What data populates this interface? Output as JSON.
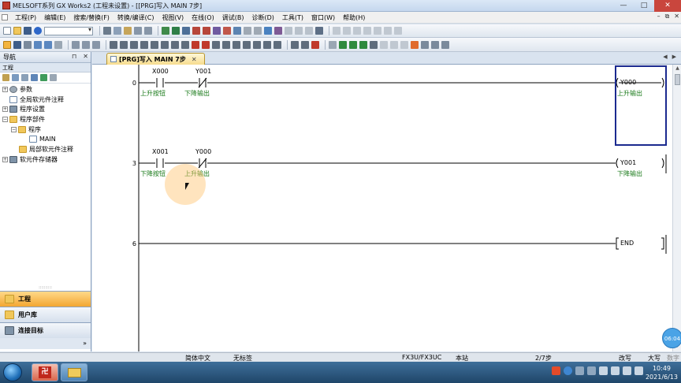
{
  "window": {
    "title": "MELSOFT系列 GX Works2 (工程未设置) - [[PRG]写入 MAIN 7步]",
    "btn_minimize": "—",
    "btn_maximize": "□",
    "btn_close": "✕"
  },
  "menubar": {
    "items": [
      "工程(P)",
      "编辑(E)",
      "搜索/替换(F)",
      "转换/编译(C)",
      "视图(V)",
      "在线(O)",
      "调试(B)",
      "诊断(D)",
      "工具(T)",
      "窗口(W)",
      "帮助(H)"
    ],
    "mdi_buttons": [
      "–",
      "⧉",
      "✕"
    ]
  },
  "navigation": {
    "title": "导航",
    "header_buttons": [
      "⊓",
      "✕"
    ],
    "section_label": "工程",
    "tree": [
      {
        "label": "参数",
        "depth": 0,
        "expander": "+",
        "icon": "gear-icon"
      },
      {
        "label": "全局软元件注释",
        "depth": 0,
        "expander": "",
        "icon": "comment-icon"
      },
      {
        "label": "程序设置",
        "depth": 0,
        "expander": "+",
        "icon": "settings-icon"
      },
      {
        "label": "程序部件",
        "depth": 0,
        "expander": "−",
        "icon": "folder-icon"
      },
      {
        "label": "程序",
        "depth": 1,
        "expander": "−",
        "icon": "folder-icon"
      },
      {
        "label": "MAIN",
        "depth": 2,
        "expander": "",
        "icon": "program-icon"
      },
      {
        "label": "局部软元件注释",
        "depth": 1,
        "expander": "",
        "icon": "folder-icon"
      },
      {
        "label": "软元件存储器",
        "depth": 0,
        "expander": "+",
        "icon": "memory-icon"
      }
    ],
    "bottom_tabs": [
      {
        "label": "工程",
        "active": true
      },
      {
        "label": "用户库",
        "active": false
      },
      {
        "label": "连接目标",
        "active": false
      }
    ],
    "footer_arrow": "»"
  },
  "editor": {
    "tab_title": "[PRG]写入 MAIN 7步",
    "tab_close": "✕",
    "tab_nav": [
      "◀",
      "▶"
    ],
    "rungs": [
      {
        "step": "0",
        "contacts": [
          {
            "device": "X000",
            "comment": "上升按钮",
            "type": "NO"
          },
          {
            "device": "Y001",
            "comment": "下降输出",
            "type": "NC"
          }
        ],
        "coil": {
          "device": "Y000",
          "comment": "上升输出"
        }
      },
      {
        "step": "3",
        "contacts": [
          {
            "device": "X001",
            "comment": "下降按钮",
            "type": "NO"
          },
          {
            "device": "Y000",
            "comment": "上升输出",
            "type": "NC"
          }
        ],
        "coil": {
          "device": "Y001",
          "comment": "下降输出"
        }
      },
      {
        "step": "6",
        "contacts": [],
        "coil": {
          "device": "END",
          "comment": ""
        }
      }
    ]
  },
  "statusbar": {
    "language": "简体中文",
    "label_mode": "无标签",
    "plc_type": "FX3U/FX3UC",
    "station": "本站",
    "steps": "2/7步",
    "mode": "改写",
    "caps": "大写",
    "numlock": "数字"
  },
  "taskbar": {
    "time": "10:49",
    "date": "2021/6/13",
    "recorder_time": "06:04"
  },
  "colors": {
    "comment_text": "#1a7a1a",
    "cursor_box": "#1b2a8f",
    "active_nav_tab": "#f3a632",
    "doc_tab": "#f7dc8e"
  }
}
